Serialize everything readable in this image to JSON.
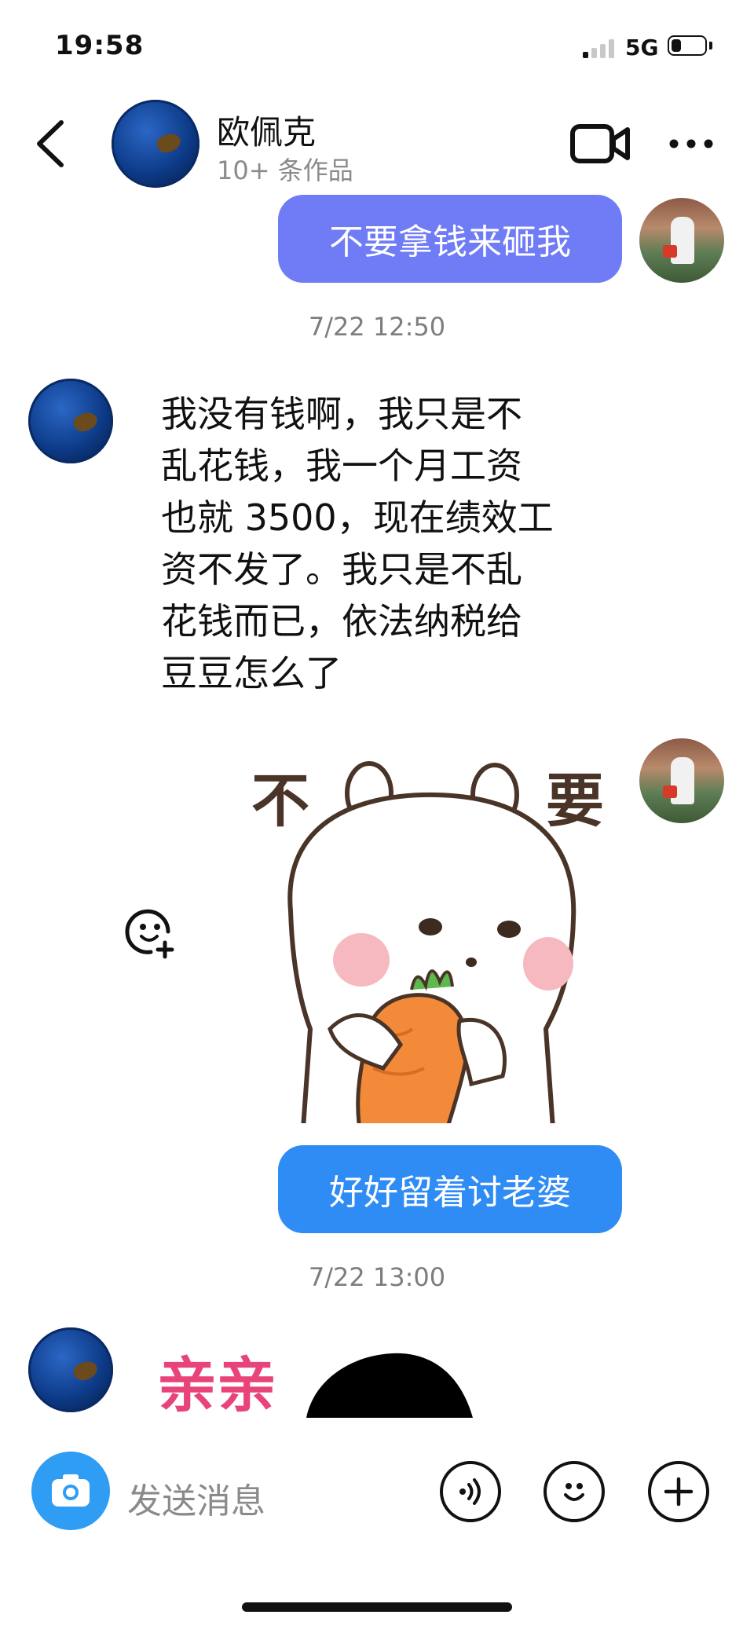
{
  "status_bar": {
    "time": "19:58",
    "network": "5G",
    "battery_level": 0.3
  },
  "header": {
    "back_icon": "chevron-left-icon",
    "contact_name": "欧佩克",
    "contact_subtitle": "10+ 条作品",
    "video_icon": "video-camera-icon",
    "more_icon": "more-dots-icon"
  },
  "messages": [
    {
      "direction": "outgoing",
      "type": "text",
      "text": "不要拿钱来砸我"
    },
    {
      "type": "timestamp",
      "text": "7/22 12:50"
    },
    {
      "direction": "incoming",
      "type": "text",
      "lines": [
        "我没有钱啊，我只是不",
        "乱花钱，我一个月工资",
        "也就 3500，现在绩效工",
        "资不发了。我只是不乱",
        "花钱而已，依法纳税给",
        "豆豆怎么了"
      ]
    },
    {
      "direction": "outgoing",
      "type": "sticker",
      "sticker_text_left": "不",
      "sticker_text_right": "要",
      "sticker": "bunny-holding-carrot"
    },
    {
      "direction": "outgoing",
      "type": "text",
      "text": "好好留着讨老婆"
    },
    {
      "type": "timestamp",
      "text": "7/22 13:00"
    },
    {
      "direction": "incoming",
      "type": "sticker",
      "sticker_text": "亲亲"
    }
  ],
  "input_bar": {
    "camera_icon": "camera-icon",
    "placeholder": "发送消息",
    "voice_icon": "voice-icon",
    "emoji_icon": "emoji-icon",
    "plus_icon": "plus-icon"
  },
  "colors": {
    "outgoing_bubble_1": "#6f7cf6",
    "outgoing_bubble_2": "#2f8cf4",
    "camera_button": "#2f9df4",
    "qinqin_text": "#e8447a"
  }
}
